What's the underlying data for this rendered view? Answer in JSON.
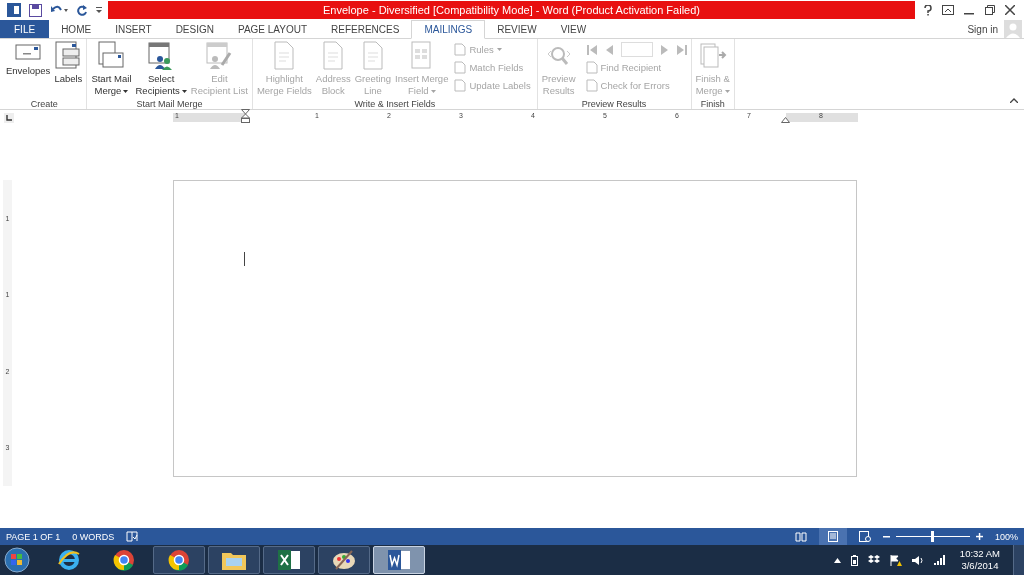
{
  "window": {
    "title": "Envelope - Diversified [Compatibility Mode] -  Word (Product Activation Failed)"
  },
  "tabs": [
    {
      "label": "FILE",
      "kind": "file",
      "selected": false
    },
    {
      "label": "HOME",
      "kind": "tab",
      "selected": false
    },
    {
      "label": "INSERT",
      "kind": "tab",
      "selected": false
    },
    {
      "label": "DESIGN",
      "kind": "tab",
      "selected": false
    },
    {
      "label": "PAGE LAYOUT",
      "kind": "tab",
      "selected": false
    },
    {
      "label": "REFERENCES",
      "kind": "tab",
      "selected": false
    },
    {
      "label": "MAILINGS",
      "kind": "tab",
      "selected": true
    },
    {
      "label": "REVIEW",
      "kind": "tab",
      "selected": false
    },
    {
      "label": "VIEW",
      "kind": "tab",
      "selected": false
    }
  ],
  "sign_in": "Sign in",
  "ribbon": [
    {
      "name": "Create",
      "items": [
        {
          "kind": "large",
          "lines": [
            "Envelopes"
          ],
          "dropdown": false,
          "disabled": false
        },
        {
          "kind": "large",
          "lines": [
            "Labels"
          ],
          "dropdown": false,
          "disabled": false
        }
      ]
    },
    {
      "name": "Start Mail Merge",
      "items": [
        {
          "kind": "large",
          "lines": [
            "Start Mail",
            "Merge"
          ],
          "dropdown": true,
          "disabled": false
        },
        {
          "kind": "large",
          "lines": [
            "Select",
            "Recipients"
          ],
          "dropdown": true,
          "disabled": false
        },
        {
          "kind": "large",
          "lines": [
            "Edit",
            "Recipient List"
          ],
          "dropdown": false,
          "disabled": true
        }
      ]
    },
    {
      "name": "Write & Insert Fields",
      "items": [
        {
          "kind": "large",
          "lines": [
            "Highlight",
            "Merge Fields"
          ],
          "dropdown": false,
          "disabled": true
        },
        {
          "kind": "large",
          "lines": [
            "Address",
            "Block"
          ],
          "dropdown": false,
          "disabled": true
        },
        {
          "kind": "large",
          "lines": [
            "Greeting",
            "Line"
          ],
          "dropdown": false,
          "disabled": true
        },
        {
          "kind": "large",
          "lines": [
            "Insert Merge",
            "Field"
          ],
          "dropdown": true,
          "disabled": true
        },
        {
          "kind": "small",
          "items": [
            {
              "label": "Rules",
              "dropdown": true,
              "disabled": true
            },
            {
              "label": "Match Fields",
              "dropdown": false,
              "disabled": true
            },
            {
              "label": "Update Labels",
              "dropdown": false,
              "disabled": true
            }
          ]
        }
      ]
    },
    {
      "name": "Preview Results",
      "items": [
        {
          "kind": "large",
          "lines": [
            "Preview",
            "Results"
          ],
          "dropdown": false,
          "disabled": true
        },
        {
          "kind": "nav",
          "items": [
            {
              "label": "Find Recipient",
              "disabled": true
            },
            {
              "label": "Check for Errors",
              "disabled": true
            }
          ]
        }
      ]
    },
    {
      "name": "Finish",
      "items": [
        {
          "kind": "large",
          "lines": [
            "Finish &",
            "Merge"
          ],
          "dropdown": true,
          "disabled": true
        }
      ]
    }
  ],
  "ruler": {
    "numbers": [
      "1",
      "1",
      "2",
      "3",
      "4",
      "5",
      "6",
      "7",
      "8"
    ],
    "vertical_numbers": [
      "1",
      "1",
      "2",
      "3"
    ]
  },
  "status_bar": {
    "page": "PAGE 1 OF 1",
    "words": "0 WORDS",
    "zoom": {
      "level": 0.5,
      "reading": "100%"
    }
  },
  "taskbar": {
    "apps": [
      {
        "kind": "ie",
        "selected": false
      },
      {
        "kind": "chrome",
        "selected": false
      },
      {
        "kind": "chrome",
        "selected": false
      },
      {
        "kind": "folder",
        "selected": false
      },
      {
        "kind": "excel",
        "selected": false
      },
      {
        "kind": "paint",
        "selected": false
      },
      {
        "kind": "word",
        "selected": true
      }
    ],
    "time": "10:32 AM",
    "date": "3/6/2014"
  }
}
